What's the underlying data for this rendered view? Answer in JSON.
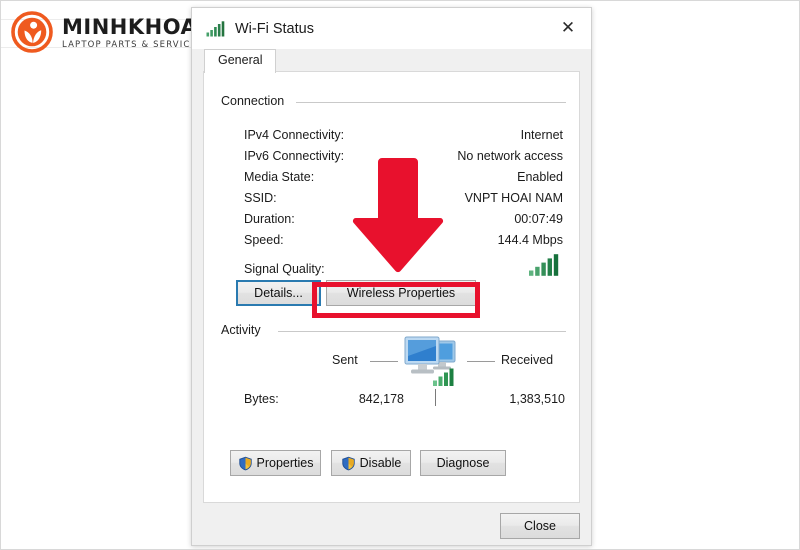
{
  "brand": {
    "name": "MINHKHOA",
    "tagline": "LAPTOP PARTS & SERVICES",
    "logo_icon": "person-leaf-circle-icon",
    "accent_color": "#ef5a1f"
  },
  "dialog": {
    "title": "Wi-Fi Status",
    "title_icon": "wifi-signal-bars-icon",
    "close_label": "✕",
    "tabs": [
      {
        "label": "General",
        "selected": true
      }
    ],
    "connection": {
      "group_label": "Connection",
      "rows": [
        {
          "label": "IPv4 Connectivity:",
          "value": "Internet"
        },
        {
          "label": "IPv6 Connectivity:",
          "value": "No network access"
        },
        {
          "label": "Media State:",
          "value": "Enabled"
        },
        {
          "label": "SSID:",
          "value": "VNPT HOAI NAM"
        },
        {
          "label": "Duration:",
          "value": "00:07:49"
        },
        {
          "label": "Speed:",
          "value": "144.4 Mbps"
        }
      ],
      "signal_quality": {
        "label": "Signal Quality:",
        "icon": "signal-bars-icon",
        "bars": 5
      },
      "buttons": [
        {
          "label": "Details...",
          "focused": true
        },
        {
          "label": "Wireless Properties",
          "highlighted": true
        }
      ]
    },
    "activity": {
      "group_label": "Activity",
      "sent_label": "Sent",
      "received_label": "Received",
      "icon": "two-monitors-network-icon",
      "bytes_label": "Bytes:",
      "bytes_sent": "842,178",
      "bytes_received": "1,383,510"
    },
    "actions": [
      {
        "label": "Properties",
        "icon": "uac-shield-icon"
      },
      {
        "label": "Disable",
        "icon": "uac-shield-icon"
      },
      {
        "label": "Diagnose",
        "icon": null
      }
    ],
    "footer": {
      "close_label": "Close"
    }
  },
  "annotation": {
    "arrow_icon": "down-arrow-icon",
    "arrow_color": "#e8112d",
    "highlight_color": "#e8112d",
    "highlight_target": "Wireless Properties"
  }
}
